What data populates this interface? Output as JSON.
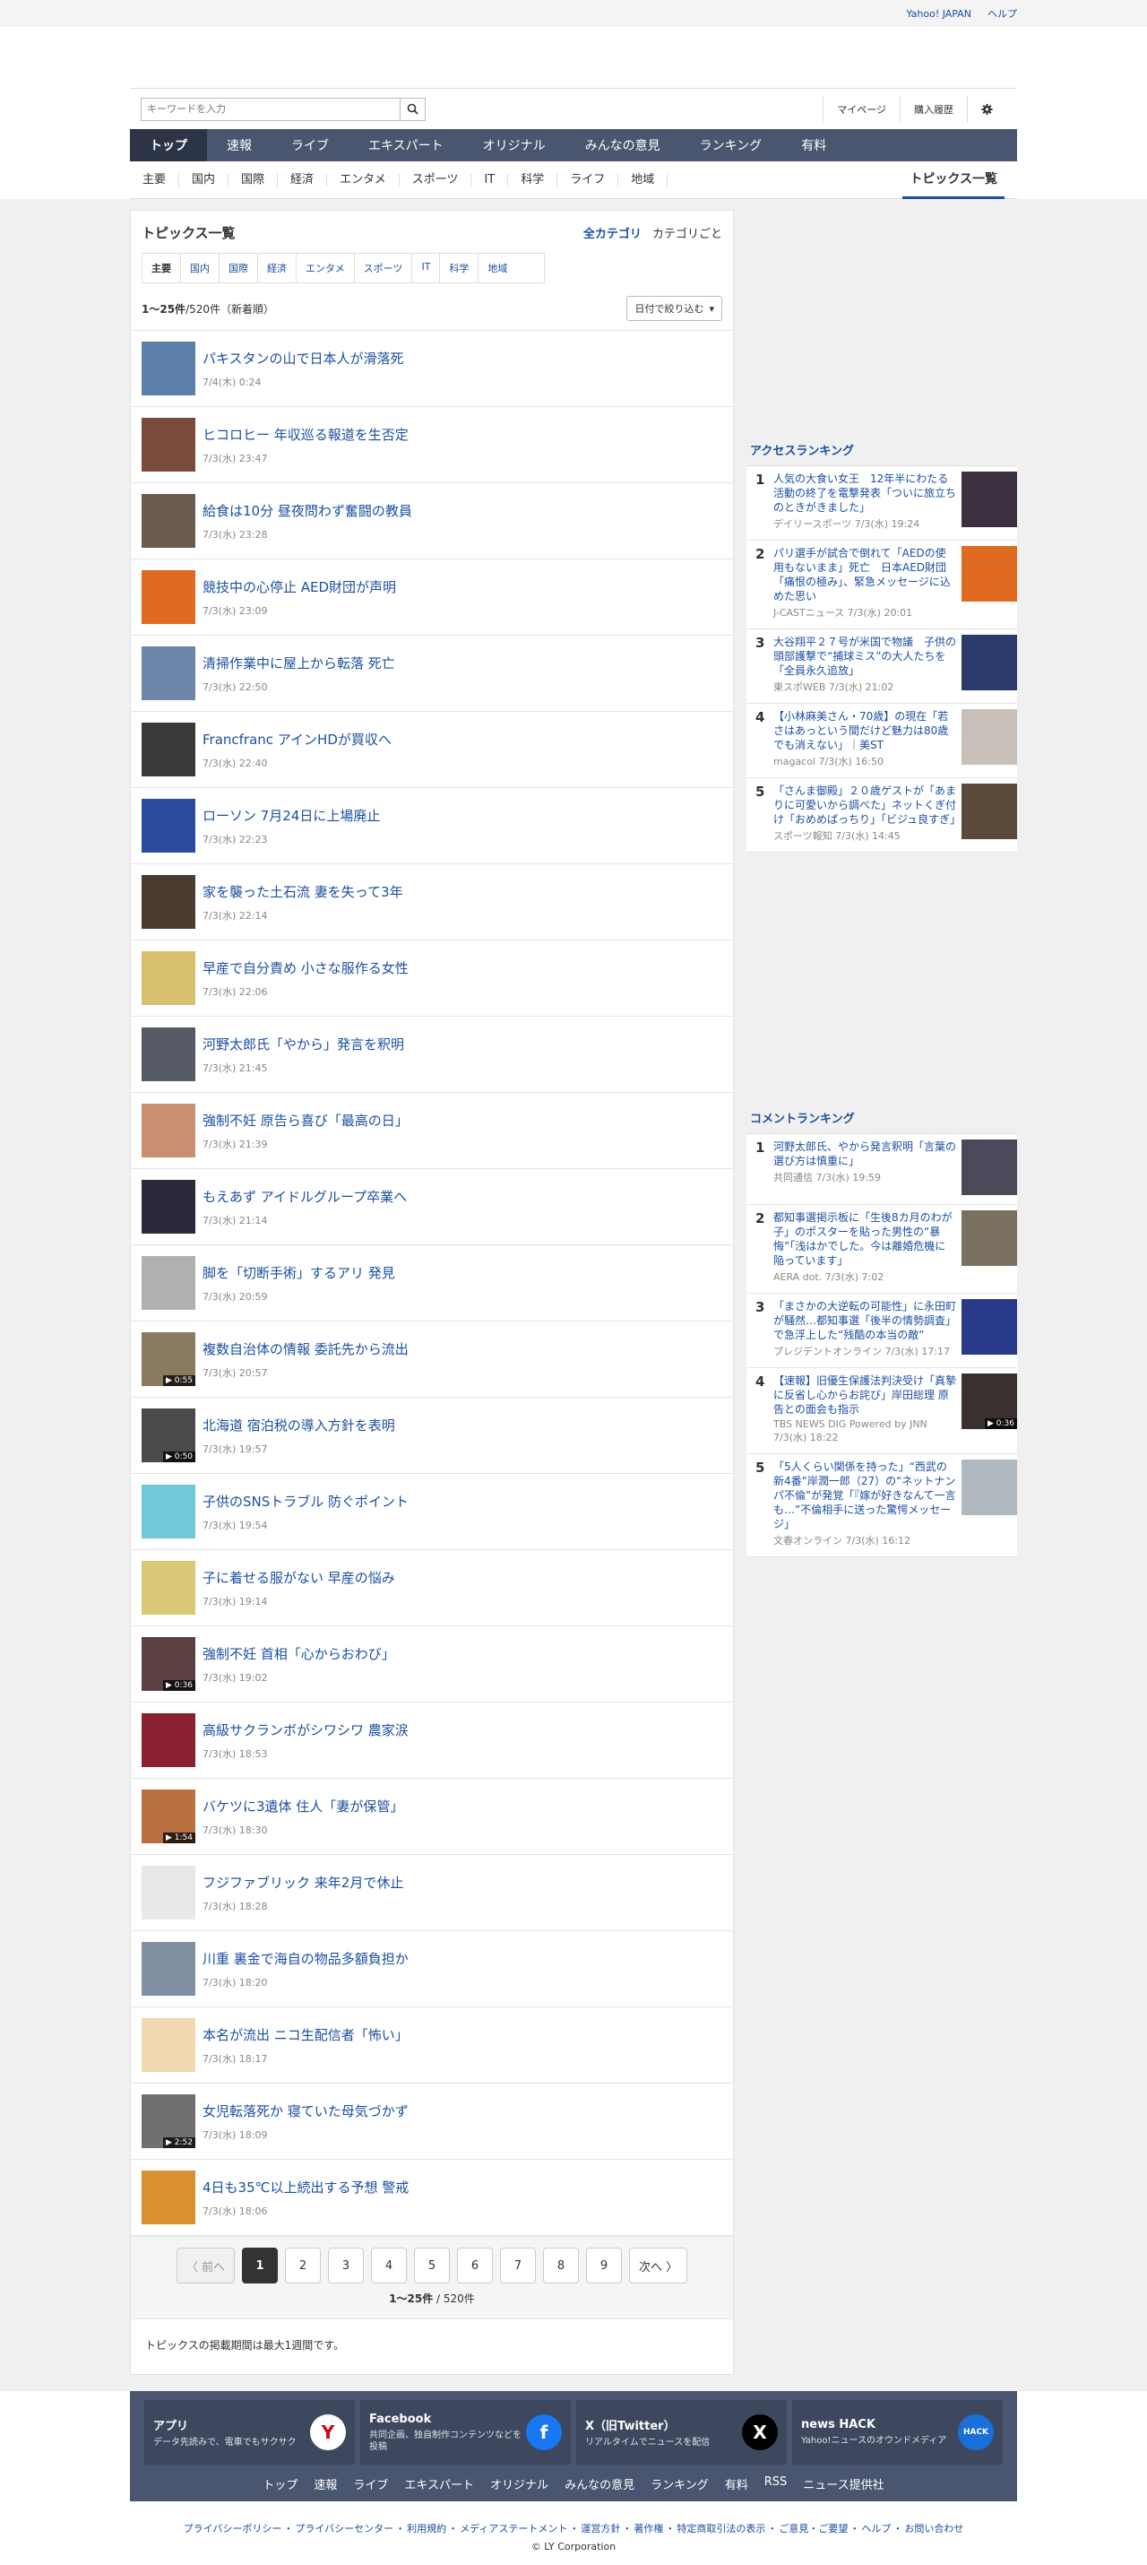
{
  "topbar": {
    "links": [
      "Yahoo! JAPAN",
      "ヘルプ"
    ]
  },
  "search": {
    "placeholder": "キーワードを入力"
  },
  "util": {
    "mypage": "マイページ",
    "history": "購入履歴"
  },
  "mainnav": [
    "トップ",
    "速報",
    "ライブ",
    "エキスパート",
    "オリジナル",
    "みんなの意見",
    "ランキング",
    "有料"
  ],
  "subnav": [
    "主要",
    "国内",
    "国際",
    "経済",
    "エンタメ",
    "スポーツ",
    "IT",
    "科学",
    "ライフ",
    "地域"
  ],
  "subnav_topics": "トピックス一覧",
  "main": {
    "title": "トピックス一覧",
    "cat_all": "全カテゴリ",
    "cat_each": "カテゴリごと",
    "tabs": [
      "主要",
      "国内",
      "国際",
      "経済",
      "エンタメ",
      "スポーツ",
      "IT",
      "科学",
      "地域"
    ],
    "count_bold": "1〜25件",
    "count_rest": "/520件（新着順）",
    "filter": "日付で絞り込む",
    "items": [
      {
        "title": "パキスタンの山で日本人が滑落死",
        "date": "7/4(木) 0:24",
        "color": "#5b7fa8",
        "dur": ""
      },
      {
        "title": "ヒコロヒー 年収巡る報道を生否定",
        "date": "7/3(水) 23:47",
        "color": "#7a4a3a",
        "dur": ""
      },
      {
        "title": "給食は10分 昼夜問わず奮闘の教員",
        "date": "7/3(水) 23:28",
        "color": "#6a5a50",
        "dur": ""
      },
      {
        "title": "競技中の心停止 AED財団が声明",
        "date": "7/3(水) 23:09",
        "color": "#e06a20",
        "dur": ""
      },
      {
        "title": "清掃作業中に屋上から転落 死亡",
        "date": "7/3(水) 22:50",
        "color": "#6b86a8",
        "dur": ""
      },
      {
        "title": "Francfranc アインHDが買収へ",
        "date": "7/3(水) 22:40",
        "color": "#3a3a3a",
        "dur": ""
      },
      {
        "title": "ローソン 7月24日に上場廃止",
        "date": "7/3(水) 22:23",
        "color": "#2a4aa0",
        "dur": ""
      },
      {
        "title": "家を襲った土石流 妻を失って3年",
        "date": "7/3(水) 22:14",
        "color": "#4a3a30",
        "dur": ""
      },
      {
        "title": "早産で自分責め 小さな服作る女性",
        "date": "7/3(水) 22:06",
        "color": "#d8c070",
        "dur": ""
      },
      {
        "title": "河野太郎氏「やから」発言を釈明",
        "date": "7/3(水) 21:45",
        "color": "#555a66",
        "dur": ""
      },
      {
        "title": "強制不妊 原告ら喜び「最高の日」",
        "date": "7/3(水) 21:39",
        "color": "#c89070",
        "dur": ""
      },
      {
        "title": "もえあず アイドルグループ卒業へ",
        "date": "7/3(水) 21:14",
        "color": "#2a2a3a",
        "dur": ""
      },
      {
        "title": "脚を「切断手術」するアリ 発見",
        "date": "7/3(水) 20:59",
        "color": "#b0b0b0",
        "dur": ""
      },
      {
        "title": "複数自治体の情報 委託先から流出",
        "date": "7/3(水) 20:57",
        "color": "#8a7a60",
        "dur": "▶ 0:55"
      },
      {
        "title": "北海道 宿泊税の導入方針を表明",
        "date": "7/3(水) 19:57",
        "color": "#4a4a4a",
        "dur": "▶ 0:50"
      },
      {
        "title": "子供のSNSトラブル 防ぐポイント",
        "date": "7/3(水) 19:54",
        "color": "#70c8d8",
        "dur": ""
      },
      {
        "title": "子に着せる服がない 早産の悩み",
        "date": "7/3(水) 19:14",
        "color": "#d8c878",
        "dur": ""
      },
      {
        "title": "強制不妊 首相「心からおわび」",
        "date": "7/3(水) 19:02",
        "color": "#5a4040",
        "dur": "▶ 0:36"
      },
      {
        "title": "高級サクランボがシワシワ 農家涙",
        "date": "7/3(水) 18:53",
        "color": "#8a2030",
        "dur": ""
      },
      {
        "title": "バケツに3遺体 住人「妻が保管」",
        "date": "7/3(水) 18:30",
        "color": "#b87040",
        "dur": "▶ 1:54"
      },
      {
        "title": "フジファブリック 来年2月で休止",
        "date": "7/3(水) 18:28",
        "color": "#e8e8e8",
        "dur": ""
      },
      {
        "title": "川重 裏金で海自の物品多額負担か",
        "date": "7/3(水) 18:20",
        "color": "#8090a0",
        "dur": ""
      },
      {
        "title": "本名が流出 ニコ生配信者「怖い」",
        "date": "7/3(水) 18:17",
        "color": "#f0d8b0",
        "dur": ""
      },
      {
        "title": "女児転落死か 寝ていた母気づかず",
        "date": "7/3(水) 18:09",
        "color": "#707070",
        "dur": "▶ 2:52"
      },
      {
        "title": "4日も35℃以上続出する予想 警戒",
        "date": "7/3(水) 18:06",
        "color": "#d89030",
        "dur": ""
      }
    ],
    "pager": {
      "prev": "〈 前へ",
      "pages": [
        "1",
        "2",
        "3",
        "4",
        "5",
        "6",
        "7",
        "8",
        "9"
      ],
      "next": "次へ 〉",
      "count_bold": "1〜25件",
      "count_rest": " / 520件"
    },
    "note": "トピックスの掲載期間は最大1週間です。"
  },
  "access_ranking": {
    "title": "アクセスランキング",
    "items": [
      {
        "num": "1",
        "title": "人気の大食い女王　12年半にわたる活動の終了を電撃発表「ついに旅立ちのときがきました」",
        "source": "デイリースポーツ 7/3(水) 19:24",
        "color": "#3a3040",
        "dur": ""
      },
      {
        "num": "2",
        "title": "パリ選手が試合で倒れて「AEDの使用もないまま」死亡　日本AED財団「痛恨の極み」、緊急メッセージに込めた思い",
        "source": "J-CASTニュース 7/3(水) 20:01",
        "color": "#e06a20",
        "dur": ""
      },
      {
        "num": "3",
        "title": "大谷翔平２７号が米国で物議　子供の頭部護撃で“捕球ミス”の大人たちを「全員永久追放」",
        "source": "東スポWEB 7/3(水) 21:02",
        "color": "#2a3a6a",
        "dur": ""
      },
      {
        "num": "4",
        "title": "【小林麻美さん・70歳】の現在「若さはあっという間だけど魅力は80歳でも消えない」｜美ST",
        "source": "magacol 7/3(水) 16:50",
        "color": "#c8c0b8",
        "dur": ""
      },
      {
        "num": "5",
        "title": "「さんま御殿」２０歳ゲストが「あまりに可愛いから調べた」ネットくぎ付け「おめめぱっちり」「ビジュ良すぎ」",
        "source": "スポーツ報知 7/3(水) 14:45",
        "color": "#5a4a3a",
        "dur": ""
      }
    ]
  },
  "comment_ranking": {
    "title": "コメントランキング",
    "items": [
      {
        "num": "1",
        "title": "河野太郎氏、やから発言釈明「言葉の選び方は慎重に」",
        "source": "共同通信 7/3(水) 19:59",
        "color": "#4a4a5a",
        "dur": ""
      },
      {
        "num": "2",
        "title": "都知事選掲示板に「生後8カ月のわが子」のポスターを貼った男性の“暴悔”「浅はかでした。今は離婚危機に陥っています」",
        "source": "AERA dot. 7/3(水) 7:02",
        "color": "#7a7060",
        "dur": ""
      },
      {
        "num": "3",
        "title": "「まさかの大逆転の可能性」に永田町が騒然…都知事選「後半の情勢調査」で急浮上した“残酷の本当の敵”",
        "source": "プレジデントオンライン 7/3(水) 17:17",
        "color": "#2a3a8a",
        "dur": ""
      },
      {
        "num": "4",
        "title": "【速報】旧優生保護法判決受け「真摯に反省し心からお詫び」岸田総理 原告との面会も指示",
        "source": "TBS NEWS DIG Powered by JNN 7/3(水) 18:22",
        "color": "#3a3030",
        "dur": "▶ 0:36"
      },
      {
        "num": "5",
        "title": "「5人くらい関係を持った」“西武の新4番”岸潤一郎（27）の“ネットナンパ不倫”が発覚「『嫁が好きなんて一言も…”不倫相手に送った驚愕メッセージ」",
        "source": "文春オンライン 7/3(水) 16:12",
        "color": "#b0b8c0",
        "dur": ""
      }
    ]
  },
  "footer": {
    "promos": [
      {
        "title": "アプリ",
        "desc": "データ先読みで、電車でもサクサク",
        "icon": "Y",
        "color": "#ffffff"
      },
      {
        "title": "Facebook",
        "desc": "共同企画、独自制作コンテンツなどを投稿",
        "icon": "f",
        "color": "#1877f2"
      },
      {
        "title": "X（旧Twitter）",
        "desc": "リアルタイムでニュースを配信",
        "icon": "X",
        "color": "#000000"
      },
      {
        "title": "news HACK",
        "desc": "Yahoo!ニュースのオウンドメディア",
        "icon": "HACK",
        "color": "#1b6fd8"
      }
    ],
    "nav": [
      "トップ",
      "速報",
      "ライブ",
      "エキスパート",
      "オリジナル",
      "みんなの意見",
      "ランキング",
      "有料",
      "RSS",
      "ニュース提供社"
    ],
    "legal": [
      "プライバシーポリシー",
      "プライバシーセンター",
      "利用規約",
      "メディアステートメント",
      "運営方針",
      "著作権",
      "特定商取引法の表示",
      "ご意見・ご要望",
      "ヘルプ",
      "お問い合わせ"
    ],
    "copyright": "© LY Corporation"
  }
}
